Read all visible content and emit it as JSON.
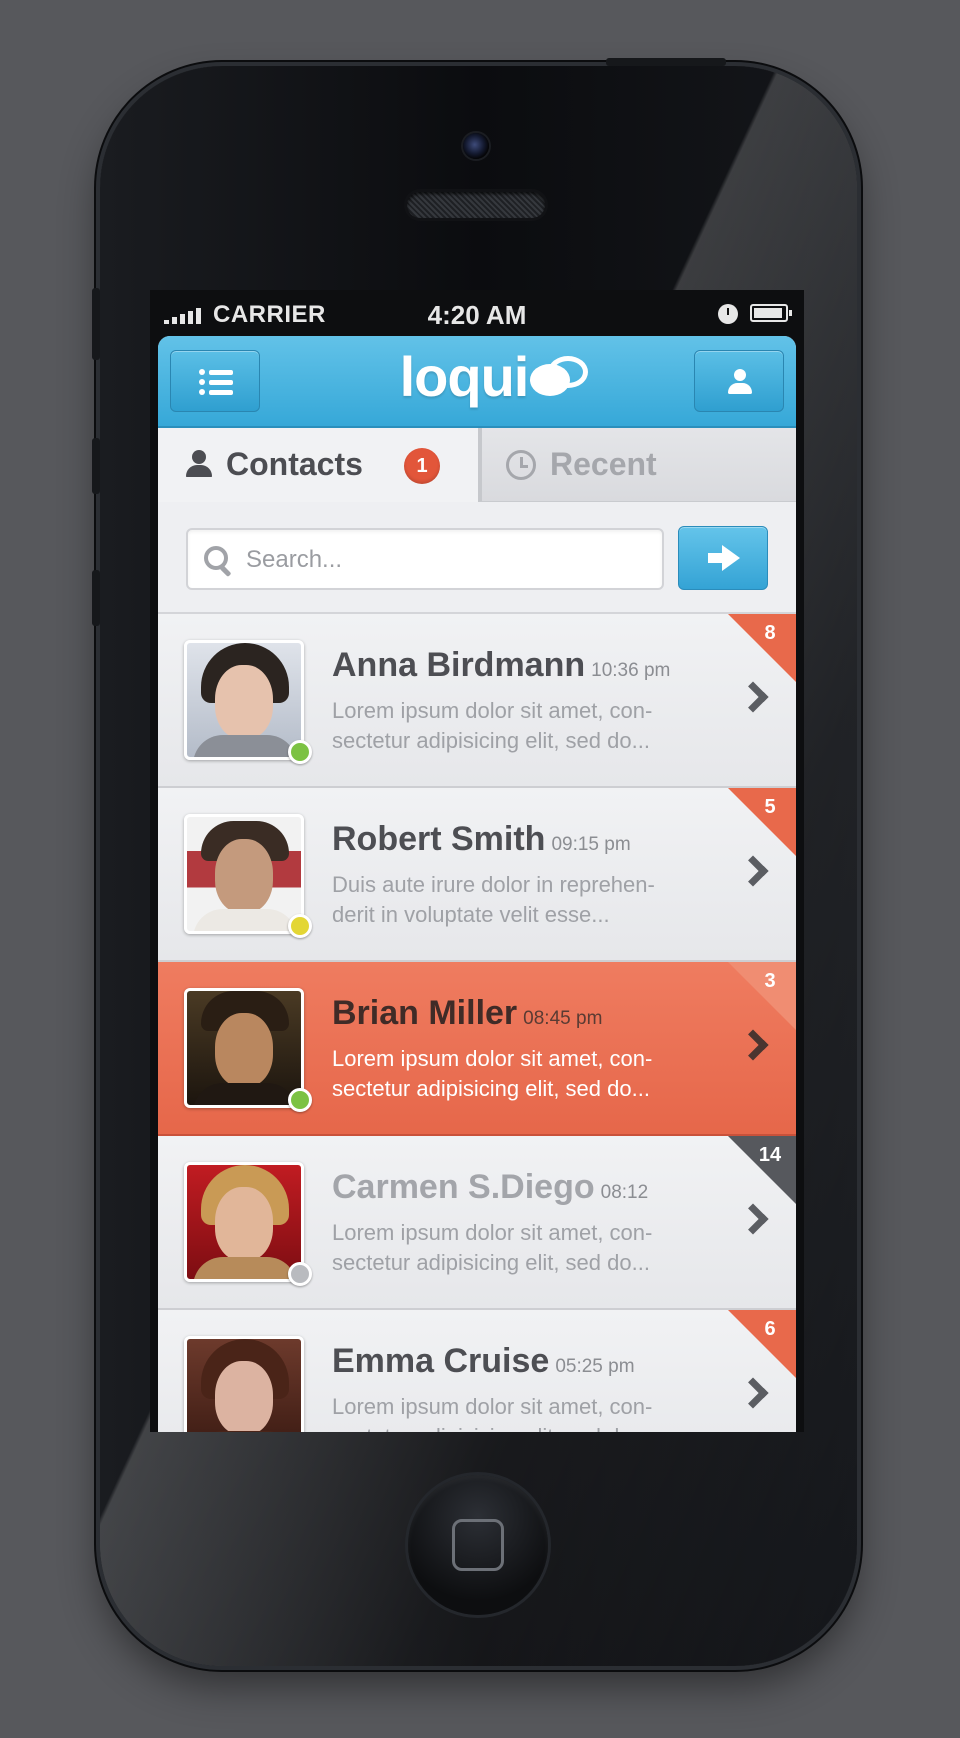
{
  "status_bar": {
    "carrier": "CARRIER",
    "time": "4:20 AM"
  },
  "app": {
    "logo": "loqui"
  },
  "tabs": [
    {
      "label": "Contacts",
      "badge": "1",
      "active": true,
      "icon": "person-icon"
    },
    {
      "label": "Recent",
      "active": false,
      "icon": "clock-icon"
    }
  ],
  "search": {
    "placeholder": "Search..."
  },
  "contacts": [
    {
      "name": "Anna Birdmann",
      "time": "10:36 pm",
      "message": "Lorem ipsum dolor sit amet, con-sectetur adipisicing elit, sed do...",
      "unread": "8",
      "status": "online",
      "status_color": "#7cc243",
      "highlighted": false
    },
    {
      "name": "Robert Smith",
      "time": "09:15 pm",
      "message": "Duis aute irure dolor in reprehen-derit in voluptate velit esse...",
      "unread": "5",
      "status": "away",
      "status_color": "#e3d635",
      "highlighted": false
    },
    {
      "name": "Brian Miller",
      "time": "08:45 pm",
      "message": "Lorem ipsum dolor sit amet, con-sectetur adipisicing elit, sed do...",
      "unread": "3",
      "status": "online",
      "status_color": "#7cc243",
      "highlighted": true
    },
    {
      "name": "Carmen S.Diego",
      "time": "08:12",
      "message": "Lorem ipsum dolor sit amet, con-sectetur adipisicing elit, sed do...",
      "unread": "14",
      "status": "offline",
      "status_color": "#b9bbbf",
      "highlighted": false
    },
    {
      "name": "Emma Cruise",
      "time": "05:25 pm",
      "message": "Lorem ipsum dolor sit amet, con-sectetur adipisicing elit, sed do...",
      "unread": "6",
      "status": "online",
      "status_color": "#7cc243",
      "highlighted": false
    }
  ],
  "colors": {
    "accent_blue": "#36a8d8",
    "accent_orange": "#e8694b",
    "dark_badge": "#56585d"
  }
}
